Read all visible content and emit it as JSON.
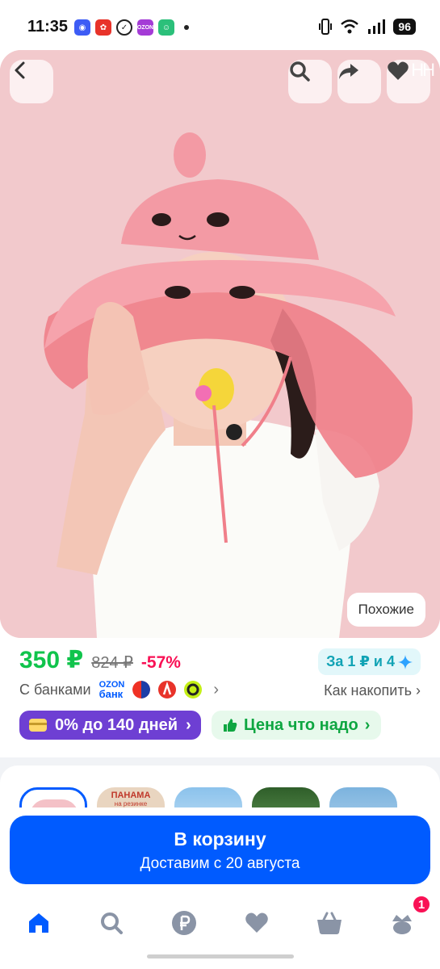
{
  "status_bar": {
    "time": "11:35",
    "app_icons": [
      "vk-icon",
      "ozon-red-icon",
      "check-icon",
      "ozon-icon",
      "game-icon"
    ],
    "battery": "96"
  },
  "hero": {
    "back_icon": "back-arrow-icon",
    "actions": [
      "search-icon",
      "share-icon",
      "heart-icon"
    ],
    "watermark": "НН",
    "similar_label": "Похожие"
  },
  "price": {
    "current": "350 ₽",
    "old": "824 ₽",
    "discount": "-57%",
    "promo": "За 1 ₽ и 4"
  },
  "banks": {
    "label": "С банками",
    "ozon_line1": "OZON",
    "ozon_line2": "банк",
    "how_to_save": "Как накопить"
  },
  "offers": {
    "installment": "0% до 140 дней",
    "good_price": "Цена что надо"
  },
  "gallery": {
    "thumb_text_1": "ПАНАМА",
    "thumb_text_2": "на резинке"
  },
  "cart": {
    "title": "В корзину",
    "subtitle": "Доставим с 20 августа"
  },
  "nav": {
    "items": [
      "home-icon",
      "search-icon",
      "ruble-icon",
      "favorites-icon",
      "cart-icon",
      "profile-icon"
    ],
    "cart_badge": "1"
  },
  "colors": {
    "price_green": "#10c44c",
    "discount_pink": "#f91155",
    "ozon_blue": "#005bff",
    "installment_purple": "#6e3fd3",
    "hero_bg": "#f2c9cc"
  }
}
